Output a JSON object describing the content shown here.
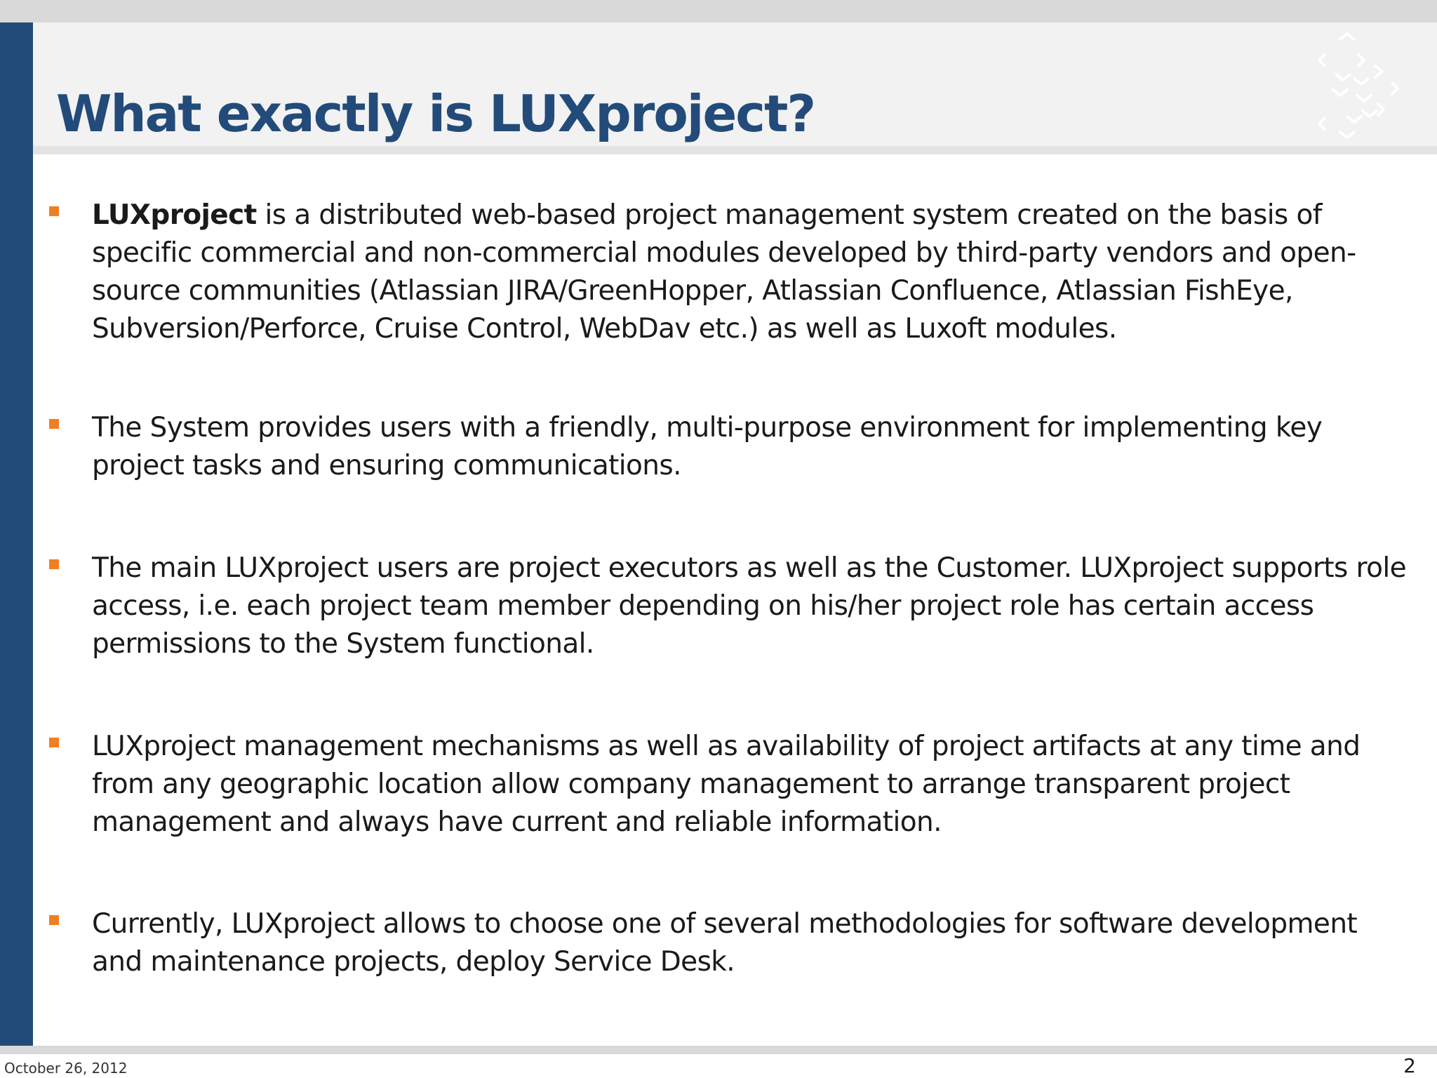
{
  "slide": {
    "title": "What exactly is LUXproject?",
    "bullets": [
      {
        "lead": "LUXproject",
        "text": "  is a distributed web-based project management system created on the basis of specific commercial and non-commercial modules developed by third-party vendors and open-source communities  (Atlassian JIRA/GreenHopper, Atlassian Confluence, Atlassian FishEye, Subversion/Perforce, Cruise Control, WebDav etc.) as well as Luxoft modules."
      },
      {
        "lead": "",
        "text": "The System provides users with a friendly, multi-purpose environment for implementing key project tasks and ensuring communications."
      },
      {
        "lead": "",
        "text": "The main LUXproject users are project executors as well as the Customer. LUXproject supports role access, i.e. each project team member depending on his/her project role has certain access permissions to the System functional."
      },
      {
        "lead": "",
        "text": "LUXproject management mechanisms as well as availability of project artifacts at any time and from any geographic location allow company management to arrange transparent project management and always have current and reliable information."
      },
      {
        "lead": "",
        "text": "Currently, LUXproject allows to choose one of several methodologies for software development and maintenance projects, deploy Service Desk."
      }
    ],
    "bullet_marker_color": "#f07f22",
    "accent_color": "#234b7a",
    "logo_icon": "luxoft-chevron-logo-icon"
  },
  "footer": {
    "date": "October 26, 2012",
    "page_number": "2"
  }
}
